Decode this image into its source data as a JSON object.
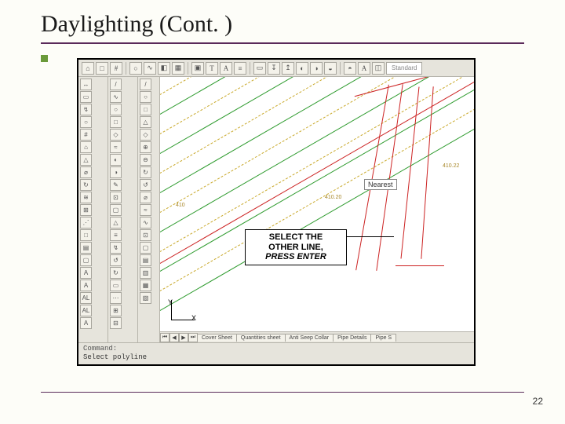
{
  "title": "Daylighting (Cont. )",
  "page_number": "22",
  "ribbon": {
    "style_box": "Standard",
    "buttons": [
      "⌂",
      "□",
      "#",
      "○",
      "∿",
      "◧",
      "▦",
      "▣",
      "T",
      "A",
      "≡",
      "▭",
      "↧",
      "↥",
      "◐",
      "◑",
      "◒",
      "◓",
      "A",
      "◫"
    ]
  },
  "palettes": {
    "p1": [
      "↔",
      "▭",
      "↯",
      "○",
      "#",
      "⌂",
      "△",
      "⌀",
      "↻",
      "≋",
      "⊞",
      "⋰",
      "□",
      "▤",
      "▢",
      "A",
      "A",
      "AL",
      "AL",
      "A"
    ],
    "p2": [
      "/",
      "∿",
      "○",
      "□",
      "◇",
      "≈",
      "◐",
      "◑",
      "✎",
      "⊡",
      "▢",
      "△",
      "≡",
      "↯",
      "↺",
      "↻",
      "▭",
      "⋯",
      "⊞",
      "⊟"
    ],
    "p3": [
      "/",
      "○",
      "□",
      "△",
      "◇",
      "⊕",
      "⊖",
      "↻",
      "↺",
      "⌀",
      "≈",
      "∿",
      "⊡",
      "▢",
      "▤",
      "▥",
      "▦",
      "▧"
    ]
  },
  "canvas": {
    "tooltip_text": "Nearest",
    "axis_y": "Y",
    "axis_x": "X",
    "elev_labels": [
      "410",
      "410.20",
      "410.22"
    ]
  },
  "callout": {
    "line1": "SELECT THE",
    "line2": "OTHER LINE,",
    "line3": "PRESS ENTER"
  },
  "tabs": {
    "items": [
      "Cover Sheet",
      "Quantities sheet",
      "Anti Seep Collar",
      "Pipe Details",
      "Pipe S"
    ]
  },
  "command": {
    "label": "Command:",
    "value": "Select polyline"
  }
}
